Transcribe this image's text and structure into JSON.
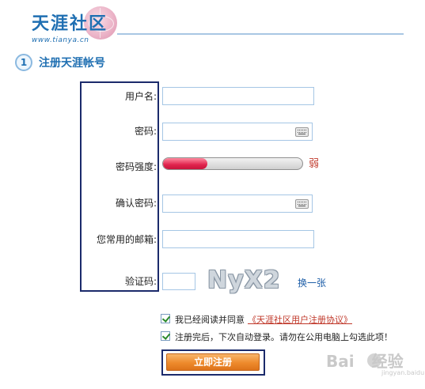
{
  "header": {
    "logo_text": "天涯社区",
    "logo_url": "www.tianya.cn"
  },
  "section": {
    "step_number": "1",
    "title": "注册天涯帐号"
  },
  "form": {
    "username_label": "用户名:",
    "password_label": "密码:",
    "strength_label": "密码强度:",
    "strength_value": "弱",
    "strength_fraction": 0.32,
    "confirm_label": "确认密码:",
    "email_label": "您常用的邮箱:",
    "captcha_label": "验证码:",
    "captcha_text": "NyX2",
    "refresh_label": "换一张"
  },
  "options": {
    "agree_text": "我已经阅读并同意",
    "agreement_link": "《天涯社区用户注册协议》",
    "autologin_text": "注册完后，下次自动登录。请勿在公用电脑上勾选此项！"
  },
  "submit_label": "立即注册",
  "watermark": {
    "brand": "Bai",
    "suffix": "经验",
    "url": "jingyan.baidu.com"
  },
  "colors": {
    "brand_blue": "#1f6fb2",
    "highlight_outline": "#1b2a6b",
    "strength_weak": "#e0244d",
    "button_orange": "#ee8a2c"
  },
  "icons": {
    "password_field": "keyboard-icon",
    "confirm_field": "keyboard-icon"
  }
}
